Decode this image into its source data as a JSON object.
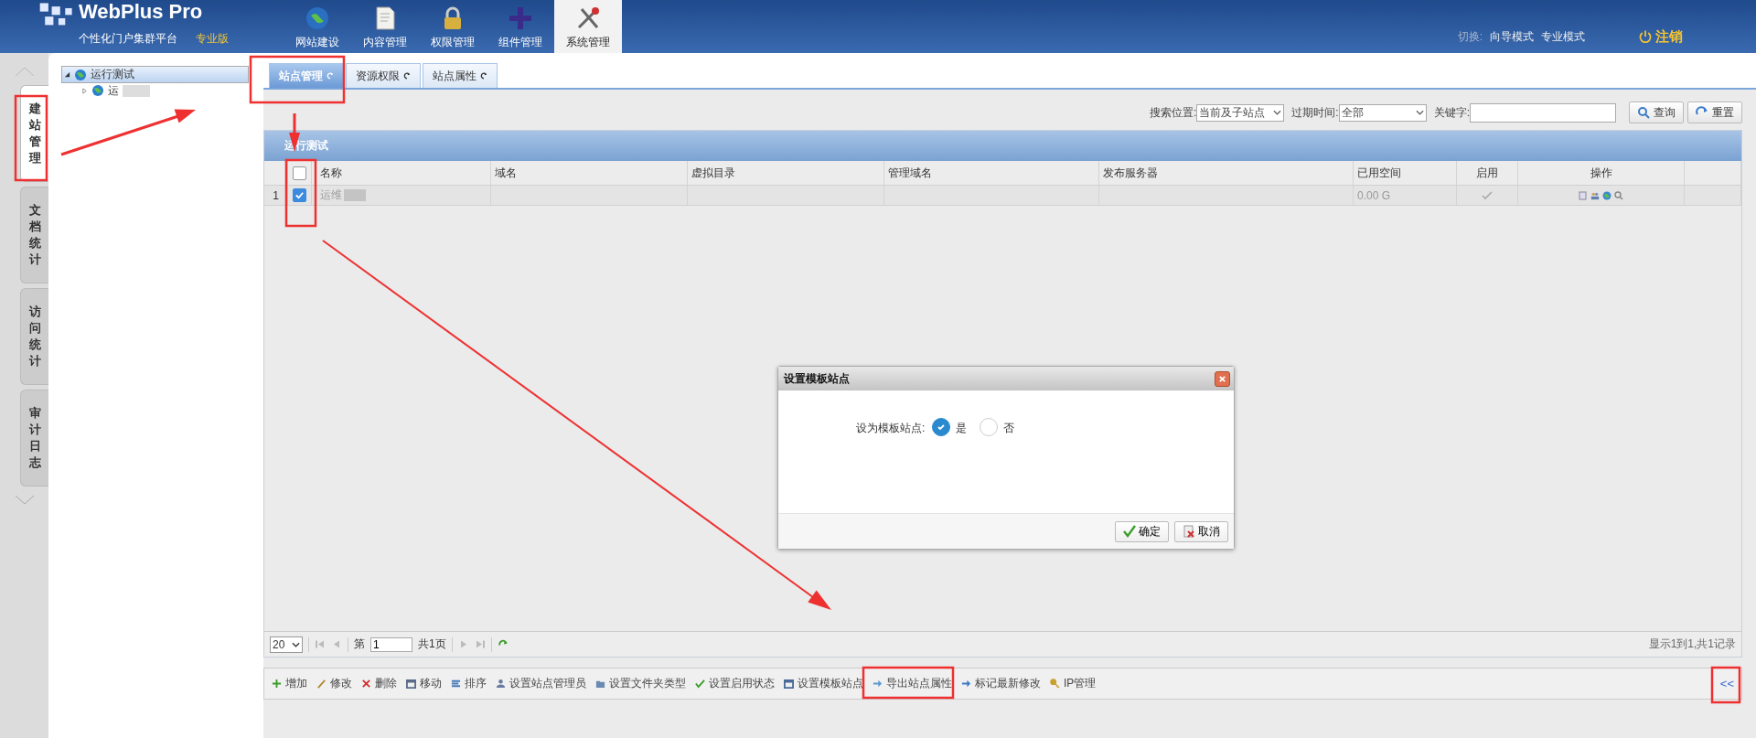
{
  "header": {
    "logo": "WebPlus Pro",
    "subtitle": "个性化门户集群平台",
    "edition": "专业版",
    "nav": [
      {
        "label": "网站建设",
        "selected": false
      },
      {
        "label": "内容管理",
        "selected": false
      },
      {
        "label": "权限管理",
        "selected": false
      },
      {
        "label": "组件管理",
        "selected": false
      },
      {
        "label": "系统管理",
        "selected": true
      }
    ],
    "switch_label": "切换:",
    "modes": [
      "向导模式",
      "专业模式"
    ],
    "logout": "注销"
  },
  "side_tabs": [
    {
      "label": "建站管理",
      "selected": true
    },
    {
      "label": "文档统计",
      "selected": false
    },
    {
      "label": "访问统计",
      "selected": false
    },
    {
      "label": "审计日志",
      "selected": false
    }
  ],
  "tree": [
    {
      "label": "运行测试",
      "expanded": true,
      "selected": true,
      "children": [
        {
          "label": "运",
          "expanded": false,
          "selected": false
        }
      ]
    }
  ],
  "tabs": [
    {
      "label": "站点管理",
      "selected": true
    },
    {
      "label": "资源权限",
      "selected": false
    },
    {
      "label": "站点属性",
      "selected": false
    }
  ],
  "search": {
    "location_label": "搜索位置:",
    "location": "当前及子站点",
    "expiry_label": "过期时间:",
    "expiry": "全部",
    "keyword_label": "关键字:",
    "buttons": [
      "查询",
      "重置"
    ]
  },
  "grid": {
    "title": "运行测试",
    "all_checked": false,
    "columns": [
      "名称",
      "域名",
      "虚拟目录",
      "管理域名",
      "发布服务器",
      "已用空间",
      "启用",
      "操作"
    ],
    "rows": [
      {
        "index": "1",
        "checked": true,
        "name": "运维",
        "used_space": "0.00 G",
        "enabled": true
      }
    ]
  },
  "pager": {
    "page_size": "20",
    "page_prefix": "第",
    "page": "1",
    "page_total": "共1页",
    "summary": "显示1到1,共1记录"
  },
  "toolbar": {
    "buttons": [
      "增加",
      "修改",
      "删除",
      "移动",
      "排序",
      "设置站点管理员",
      "设置文件夹类型",
      "设置启用状态",
      "设置模板站点",
      "导出站点属性",
      "标记最新修改",
      "IP管理"
    ],
    "collapse": "<<"
  },
  "dialog": {
    "title": "设置模板站点",
    "label": "设为模板站点:",
    "options": [
      {
        "label": "是",
        "selected": true
      },
      {
        "label": "否",
        "selected": false
      }
    ],
    "buttons": [
      "确定",
      "取消"
    ]
  }
}
